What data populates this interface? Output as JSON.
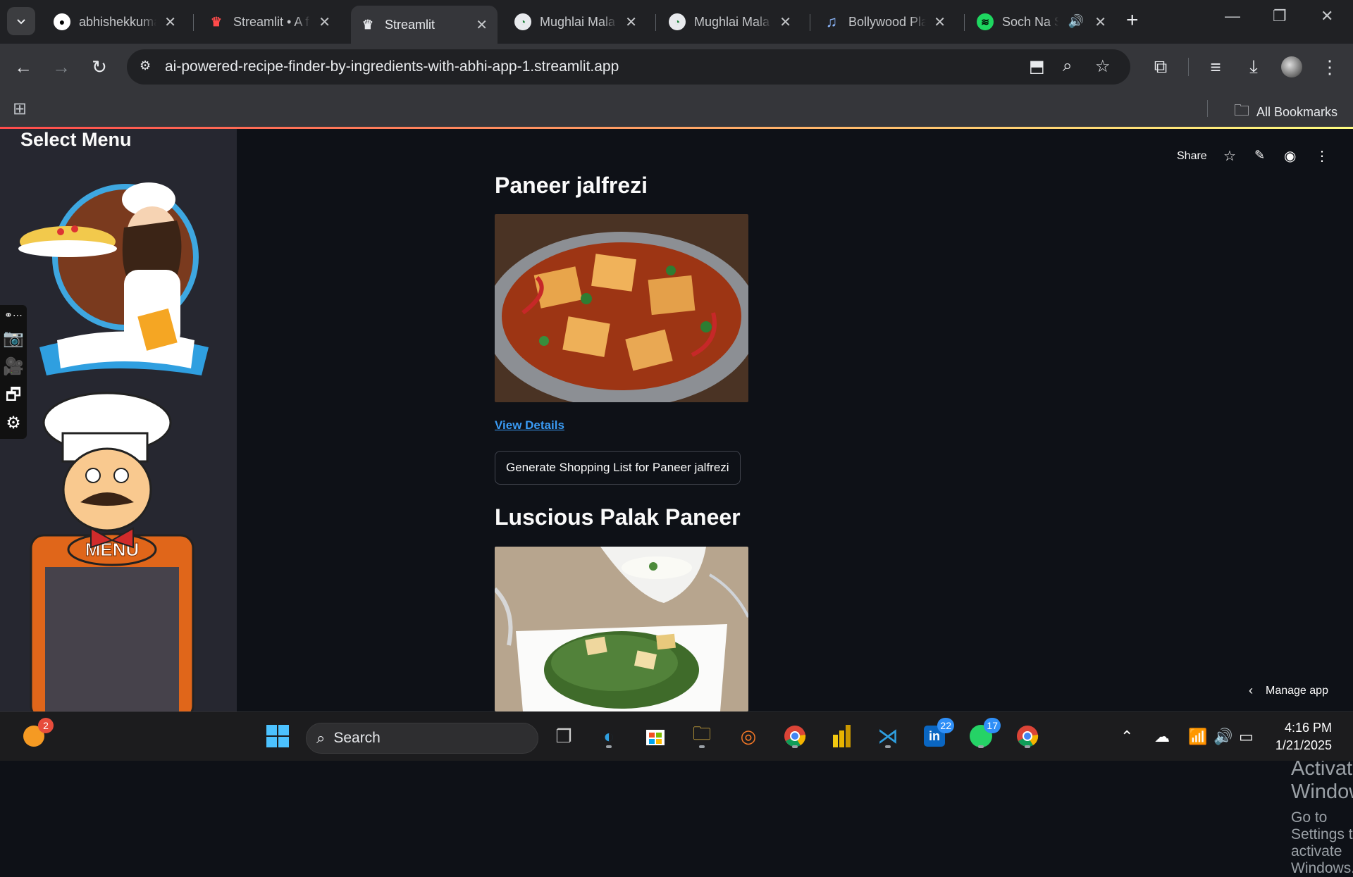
{
  "browser": {
    "tabs": [
      {
        "title": "abhishekkuma",
        "icon": "github-icon",
        "active": false
      },
      {
        "title": "Streamlit • A f",
        "icon": "streamlit-crown-red-icon",
        "active": false
      },
      {
        "title": "Streamlit",
        "icon": "streamlit-crown-icon",
        "active": true
      },
      {
        "title": "Mughlai Mala",
        "icon": "chrome-globe-icon",
        "active": false
      },
      {
        "title": "Mughlai Mala",
        "icon": "chrome-globe-icon",
        "active": false
      },
      {
        "title": "Bollywood Pla",
        "icon": "music-note-icon",
        "active": false
      },
      {
        "title": "Soch Na S",
        "icon": "spotify-icon",
        "active": false
      }
    ],
    "url": "ai-powered-recipe-finder-by-ingredients-with-abhi-app-1.streamlit.app",
    "bookmarks_label": "All Bookmarks"
  },
  "sidebar": {
    "title": "Select Menu"
  },
  "header": {
    "share_label": "Share"
  },
  "recipes": [
    {
      "title": "Paneer jalfrezi",
      "link_label": "View Details",
      "button_label": "Generate Shopping List for Paneer jalfrezi"
    },
    {
      "title": "Luscious Palak Paneer"
    }
  ],
  "watermark": {
    "line1": "Activate Windows",
    "line2": "Go to Settings to activate Windows."
  },
  "manage_app": "Manage app",
  "taskbar": {
    "search_placeholder": "Search",
    "badge_weather": "2",
    "badge_linkedin": "22",
    "badge_whatsapp": "17",
    "time": "4:16 PM",
    "date": "1/21/2025"
  },
  "colors": {
    "accent_link": "#3a9bf4",
    "sidebar_bg": "#262730",
    "main_bg": "#0e1117",
    "header_gradient": [
      "#ff4b4b",
      "#fffd80"
    ]
  }
}
